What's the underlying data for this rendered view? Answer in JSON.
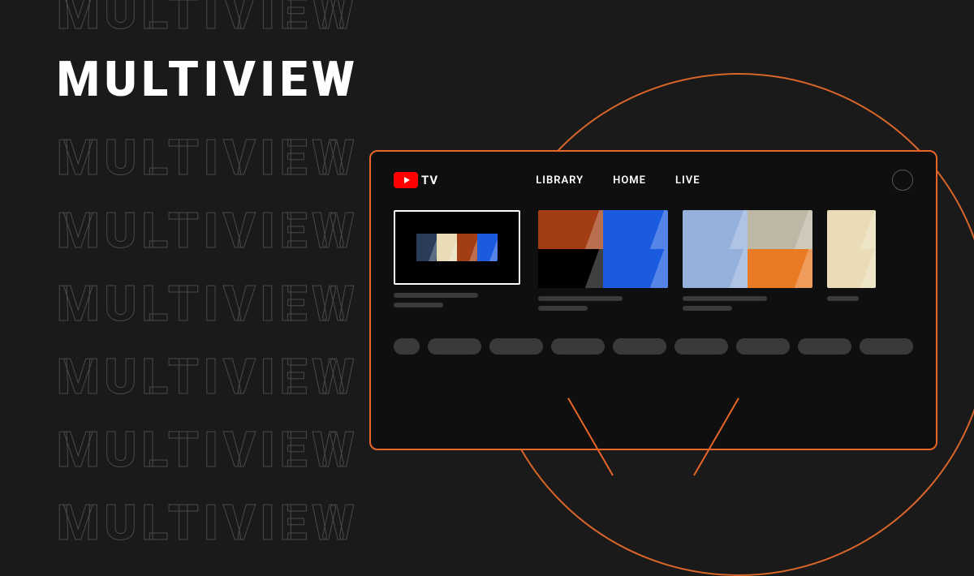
{
  "background_word": "MULTIVIEW",
  "title": "MULTIVIEW",
  "logo_text": "TV",
  "nav": {
    "library": "LIBRARY",
    "home": "HOME",
    "live": "LIVE"
  },
  "colors": {
    "accent": "#e8652a",
    "brand_red": "#ff0000"
  }
}
